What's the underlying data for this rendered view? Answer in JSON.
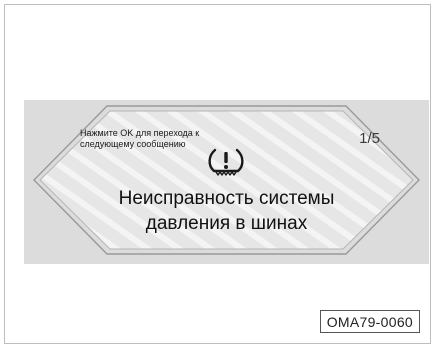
{
  "display": {
    "hint": "Нажмите OK для перехода к следующему сообщению",
    "page_counter": "1/5",
    "message_line1": "Неисправность системы",
    "message_line2": "давления в шинах",
    "icon": "tire-pressure-warning-icon"
  },
  "figure_reference": "OMA79-0060"
}
